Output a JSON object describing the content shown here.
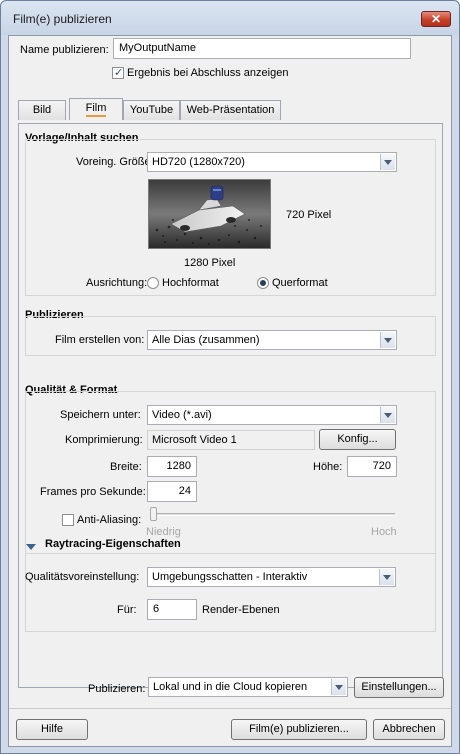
{
  "window": {
    "title": "Film(e) publizieren",
    "close_glyph": "✕"
  },
  "name_field": {
    "label": "Name publizieren:",
    "value": "MyOutputName"
  },
  "show_result": {
    "label": "Ergebnis bei Abschluss anzeigen",
    "checked": true
  },
  "tabs": [
    {
      "label": "Bild",
      "active": false
    },
    {
      "label": "Film",
      "active": true
    },
    {
      "label": "YouTube",
      "active": false
    },
    {
      "label": "Web-Präsentation",
      "active": false
    }
  ],
  "template_section": {
    "title": "Vorlage/Inhalt suchen",
    "preset_label": "Voreing. Größe:",
    "preset_value": "HD720 (1280x720)",
    "height_text": "720 Pixel",
    "width_text": "1280 Pixel",
    "orientation_label": "Ausrichtung:",
    "portrait_label": "Hochformat",
    "landscape_label": "Querformat",
    "orientation_selected": "landscape"
  },
  "publish_section": {
    "title": "Publizieren",
    "create_from_label": "Film erstellen von:",
    "create_from_value": "Alle Dias (zusammen)"
  },
  "quality_section": {
    "title": "Qualität & Format",
    "save_as_label": "Speichern unter:",
    "save_as_value": "Video (*.avi)",
    "compression_label": "Komprimierung:",
    "compression_value": "Microsoft Video 1",
    "config_button": "Konfig...",
    "width_label": "Breite:",
    "width_value": "1280",
    "height_label": "Höhe:",
    "height_value": "720",
    "fps_label": "Frames pro Sekunde:",
    "fps_value": "24",
    "antialias_label": "Anti-Aliasing:",
    "antialias_checked": false,
    "slider_low": "Niedrig",
    "slider_high": "Hoch",
    "slider_level": 0
  },
  "raytracing_section": {
    "title": "Raytracing-Eigenschaften",
    "preset_label": "Qualitätsvoreinstellung:",
    "preset_value": "Umgebungsschatten - Interaktiv",
    "for_label": "Für:",
    "for_value": "6",
    "layers_label": "Render-Ebenen"
  },
  "bottom": {
    "publish_label": "Publizieren:",
    "publish_value": "Lokal und in die Cloud kopieren",
    "settings_button": "Einstellungen...",
    "help_button": "Hilfe",
    "publish_button": "Film(e) publizieren...",
    "cancel_button": "Abbrechen"
  },
  "colors": {
    "accent": "#e89a3c",
    "close": "#c6412a",
    "frame": "#cfd9e7"
  }
}
